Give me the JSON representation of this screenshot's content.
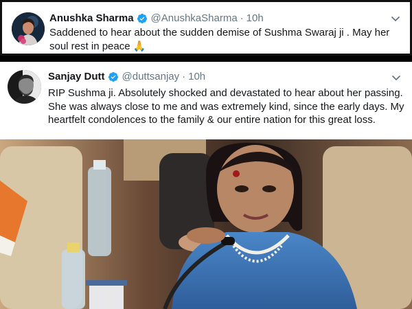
{
  "tweets": [
    {
      "display_name": "Anushka Sharma",
      "handle": "@AnushkaSharma",
      "separator": "·",
      "time": "10h",
      "text": "Saddened to hear about the sudden demise of Sushma Swaraj ji . May her soul rest in peace",
      "emoji": "🙏",
      "avatar_icon": "profile-photo"
    },
    {
      "display_name": "Sanjay Dutt",
      "handle": "@duttsanjay",
      "separator": "·",
      "time": "10h",
      "text": "RIP Sushma ji. Absolutely shocked and devastated to hear about her passing. She was always close to me and was extremely kind, since the early days. My heartfelt condolences to the family & our entire nation for this great loss.",
      "avatar_icon": "profile-photo",
      "has_photo": true
    }
  ],
  "colors": {
    "verified_blue": "#1da1f2",
    "secondary_text": "#657786",
    "primary_text": "#14171a"
  }
}
